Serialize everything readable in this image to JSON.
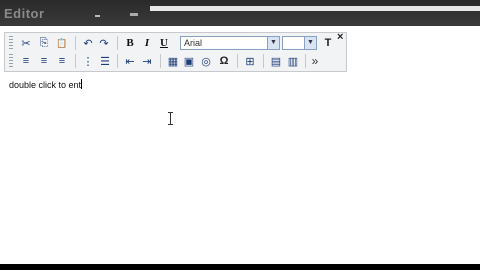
{
  "window": {
    "title": "Editor"
  },
  "toolbar": {
    "row1": {
      "cut": "✂",
      "copy": "⎘",
      "paste": "📋",
      "undo": "↶",
      "redo": "↷",
      "bold": "B",
      "italic": "I",
      "underline": "U",
      "font_family": "Arial",
      "font_size": "",
      "styles": "T"
    },
    "row2": {
      "align_left": "≡",
      "align_center": "≡",
      "align_right": "≡",
      "ordered_list": "⋮",
      "bullet_list": "☰",
      "outdent": "⇤",
      "indent": "⇥",
      "table": "▦",
      "image": "▣",
      "media": "◎",
      "special_char": "Ω",
      "template": "⊞",
      "html_source": "▤",
      "preview": "▥",
      "more": "»"
    },
    "close": "×"
  },
  "editor": {
    "content": "double click to ent"
  },
  "colors": {
    "toolbar_bg": "#f2f3f5",
    "icon": "#1d3e7a",
    "page": "#ffffff"
  }
}
